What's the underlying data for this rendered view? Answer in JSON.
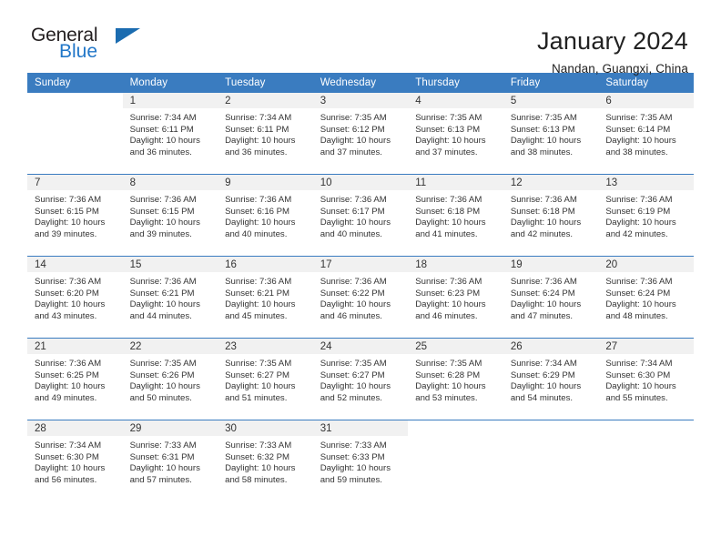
{
  "brand": {
    "name_part1": "General",
    "name_part2": "Blue",
    "triangle_color": "#1b6cb0",
    "blue_color": "#2277c8"
  },
  "header": {
    "title": "January 2024",
    "subtitle": "Nandan, Guangxi, China"
  },
  "theme": {
    "header_row_bg": "#3a7cc0",
    "daynum_bg": "#f1f1f1",
    "text_color": "#333333",
    "page_bg": "#ffffff"
  },
  "weekday_headers": [
    "Sunday",
    "Monday",
    "Tuesday",
    "Wednesday",
    "Thursday",
    "Friday",
    "Saturday"
  ],
  "labels": {
    "sunrise_prefix": "Sunrise:",
    "sunset_prefix": "Sunset:",
    "daylight_prefix": "Daylight:"
  },
  "weeks": [
    [
      {
        "day": "",
        "sunrise": "",
        "sunset": "",
        "daylight_line1": "",
        "daylight_line2": ""
      },
      {
        "day": "1",
        "sunrise": "Sunrise: 7:34 AM",
        "sunset": "Sunset: 6:11 PM",
        "daylight_line1": "Daylight: 10 hours",
        "daylight_line2": "and 36 minutes."
      },
      {
        "day": "2",
        "sunrise": "Sunrise: 7:34 AM",
        "sunset": "Sunset: 6:11 PM",
        "daylight_line1": "Daylight: 10 hours",
        "daylight_line2": "and 36 minutes."
      },
      {
        "day": "3",
        "sunrise": "Sunrise: 7:35 AM",
        "sunset": "Sunset: 6:12 PM",
        "daylight_line1": "Daylight: 10 hours",
        "daylight_line2": "and 37 minutes."
      },
      {
        "day": "4",
        "sunrise": "Sunrise: 7:35 AM",
        "sunset": "Sunset: 6:13 PM",
        "daylight_line1": "Daylight: 10 hours",
        "daylight_line2": "and 37 minutes."
      },
      {
        "day": "5",
        "sunrise": "Sunrise: 7:35 AM",
        "sunset": "Sunset: 6:13 PM",
        "daylight_line1": "Daylight: 10 hours",
        "daylight_line2": "and 38 minutes."
      },
      {
        "day": "6",
        "sunrise": "Sunrise: 7:35 AM",
        "sunset": "Sunset: 6:14 PM",
        "daylight_line1": "Daylight: 10 hours",
        "daylight_line2": "and 38 minutes."
      }
    ],
    [
      {
        "day": "7",
        "sunrise": "Sunrise: 7:36 AM",
        "sunset": "Sunset: 6:15 PM",
        "daylight_line1": "Daylight: 10 hours",
        "daylight_line2": "and 39 minutes."
      },
      {
        "day": "8",
        "sunrise": "Sunrise: 7:36 AM",
        "sunset": "Sunset: 6:15 PM",
        "daylight_line1": "Daylight: 10 hours",
        "daylight_line2": "and 39 minutes."
      },
      {
        "day": "9",
        "sunrise": "Sunrise: 7:36 AM",
        "sunset": "Sunset: 6:16 PM",
        "daylight_line1": "Daylight: 10 hours",
        "daylight_line2": "and 40 minutes."
      },
      {
        "day": "10",
        "sunrise": "Sunrise: 7:36 AM",
        "sunset": "Sunset: 6:17 PM",
        "daylight_line1": "Daylight: 10 hours",
        "daylight_line2": "and 40 minutes."
      },
      {
        "day": "11",
        "sunrise": "Sunrise: 7:36 AM",
        "sunset": "Sunset: 6:18 PM",
        "daylight_line1": "Daylight: 10 hours",
        "daylight_line2": "and 41 minutes."
      },
      {
        "day": "12",
        "sunrise": "Sunrise: 7:36 AM",
        "sunset": "Sunset: 6:18 PM",
        "daylight_line1": "Daylight: 10 hours",
        "daylight_line2": "and 42 minutes."
      },
      {
        "day": "13",
        "sunrise": "Sunrise: 7:36 AM",
        "sunset": "Sunset: 6:19 PM",
        "daylight_line1": "Daylight: 10 hours",
        "daylight_line2": "and 42 minutes."
      }
    ],
    [
      {
        "day": "14",
        "sunrise": "Sunrise: 7:36 AM",
        "sunset": "Sunset: 6:20 PM",
        "daylight_line1": "Daylight: 10 hours",
        "daylight_line2": "and 43 minutes."
      },
      {
        "day": "15",
        "sunrise": "Sunrise: 7:36 AM",
        "sunset": "Sunset: 6:21 PM",
        "daylight_line1": "Daylight: 10 hours",
        "daylight_line2": "and 44 minutes."
      },
      {
        "day": "16",
        "sunrise": "Sunrise: 7:36 AM",
        "sunset": "Sunset: 6:21 PM",
        "daylight_line1": "Daylight: 10 hours",
        "daylight_line2": "and 45 minutes."
      },
      {
        "day": "17",
        "sunrise": "Sunrise: 7:36 AM",
        "sunset": "Sunset: 6:22 PM",
        "daylight_line1": "Daylight: 10 hours",
        "daylight_line2": "and 46 minutes."
      },
      {
        "day": "18",
        "sunrise": "Sunrise: 7:36 AM",
        "sunset": "Sunset: 6:23 PM",
        "daylight_line1": "Daylight: 10 hours",
        "daylight_line2": "and 46 minutes."
      },
      {
        "day": "19",
        "sunrise": "Sunrise: 7:36 AM",
        "sunset": "Sunset: 6:24 PM",
        "daylight_line1": "Daylight: 10 hours",
        "daylight_line2": "and 47 minutes."
      },
      {
        "day": "20",
        "sunrise": "Sunrise: 7:36 AM",
        "sunset": "Sunset: 6:24 PM",
        "daylight_line1": "Daylight: 10 hours",
        "daylight_line2": "and 48 minutes."
      }
    ],
    [
      {
        "day": "21",
        "sunrise": "Sunrise: 7:36 AM",
        "sunset": "Sunset: 6:25 PM",
        "daylight_line1": "Daylight: 10 hours",
        "daylight_line2": "and 49 minutes."
      },
      {
        "day": "22",
        "sunrise": "Sunrise: 7:35 AM",
        "sunset": "Sunset: 6:26 PM",
        "daylight_line1": "Daylight: 10 hours",
        "daylight_line2": "and 50 minutes."
      },
      {
        "day": "23",
        "sunrise": "Sunrise: 7:35 AM",
        "sunset": "Sunset: 6:27 PM",
        "daylight_line1": "Daylight: 10 hours",
        "daylight_line2": "and 51 minutes."
      },
      {
        "day": "24",
        "sunrise": "Sunrise: 7:35 AM",
        "sunset": "Sunset: 6:27 PM",
        "daylight_line1": "Daylight: 10 hours",
        "daylight_line2": "and 52 minutes."
      },
      {
        "day": "25",
        "sunrise": "Sunrise: 7:35 AM",
        "sunset": "Sunset: 6:28 PM",
        "daylight_line1": "Daylight: 10 hours",
        "daylight_line2": "and 53 minutes."
      },
      {
        "day": "26",
        "sunrise": "Sunrise: 7:34 AM",
        "sunset": "Sunset: 6:29 PM",
        "daylight_line1": "Daylight: 10 hours",
        "daylight_line2": "and 54 minutes."
      },
      {
        "day": "27",
        "sunrise": "Sunrise: 7:34 AM",
        "sunset": "Sunset: 6:30 PM",
        "daylight_line1": "Daylight: 10 hours",
        "daylight_line2": "and 55 minutes."
      }
    ],
    [
      {
        "day": "28",
        "sunrise": "Sunrise: 7:34 AM",
        "sunset": "Sunset: 6:30 PM",
        "daylight_line1": "Daylight: 10 hours",
        "daylight_line2": "and 56 minutes."
      },
      {
        "day": "29",
        "sunrise": "Sunrise: 7:33 AM",
        "sunset": "Sunset: 6:31 PM",
        "daylight_line1": "Daylight: 10 hours",
        "daylight_line2": "and 57 minutes."
      },
      {
        "day": "30",
        "sunrise": "Sunrise: 7:33 AM",
        "sunset": "Sunset: 6:32 PM",
        "daylight_line1": "Daylight: 10 hours",
        "daylight_line2": "and 58 minutes."
      },
      {
        "day": "31",
        "sunrise": "Sunrise: 7:33 AM",
        "sunset": "Sunset: 6:33 PM",
        "daylight_line1": "Daylight: 10 hours",
        "daylight_line2": "and 59 minutes."
      },
      {
        "day": "",
        "sunrise": "",
        "sunset": "",
        "daylight_line1": "",
        "daylight_line2": ""
      },
      {
        "day": "",
        "sunrise": "",
        "sunset": "",
        "daylight_line1": "",
        "daylight_line2": ""
      },
      {
        "day": "",
        "sunrise": "",
        "sunset": "",
        "daylight_line1": "",
        "daylight_line2": ""
      }
    ]
  ]
}
